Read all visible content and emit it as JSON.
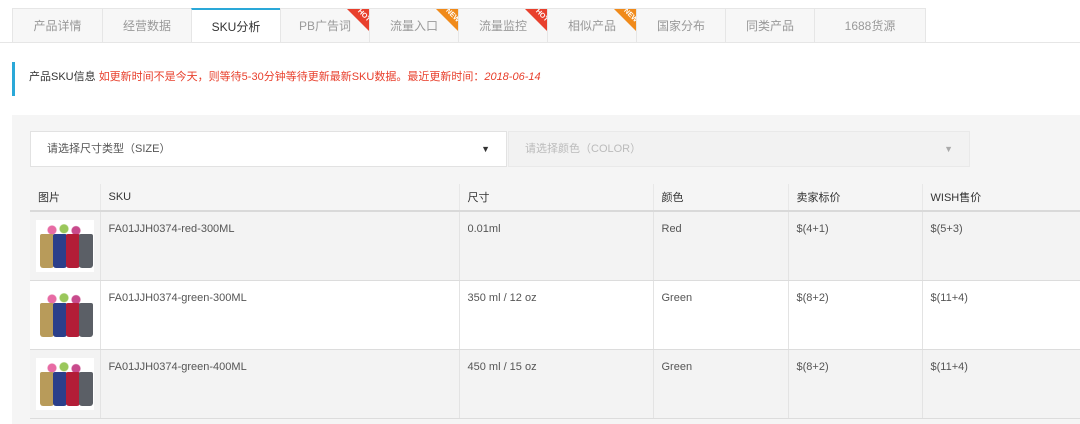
{
  "tabs": [
    {
      "label": "产品详情",
      "active": false,
      "badge": ""
    },
    {
      "label": "经营数据",
      "active": false,
      "badge": ""
    },
    {
      "label": "SKU分析",
      "active": true,
      "badge": ""
    },
    {
      "label": "PB广告词",
      "active": false,
      "badge": "HOT"
    },
    {
      "label": "流量入口",
      "active": false,
      "badge": "NEW"
    },
    {
      "label": "流量监控",
      "active": false,
      "badge": "HOT"
    },
    {
      "label": "相似产品",
      "active": false,
      "badge": "NEW"
    },
    {
      "label": "国家分布",
      "active": false,
      "badge": ""
    },
    {
      "label": "同类产品",
      "active": false,
      "badge": ""
    },
    {
      "label": "1688货源",
      "active": false,
      "badge": ""
    }
  ],
  "info": {
    "label": "产品SKU信息",
    "message": "如更新时间不是今天，则等待5-30分钟等待更新最新SKU数据。最近更新时间：",
    "date": "2018-06-14"
  },
  "filters": {
    "size_placeholder": "请选择尺寸类型（SIZE）",
    "color_placeholder": "请选择颜色（COLOR）",
    "caret": "▼"
  },
  "table": {
    "headers": [
      "图片",
      "SKU",
      "尺寸",
      "颜色",
      "卖家标价",
      "WISH售价"
    ],
    "rows": [
      {
        "sku": "FA01JJH0374-red-300ML",
        "size": "0.01ml",
        "color": "Red",
        "seller_price": "$(4+1)",
        "wish_price": "$(5+3)"
      },
      {
        "sku": "FA01JJH0374-green-300ML",
        "size": "350 ml / 12 oz",
        "color": "Green",
        "seller_price": "$(8+2)",
        "wish_price": "$(11+4)"
      },
      {
        "sku": "FA01JJH0374-green-400ML",
        "size": "450 ml / 15 oz",
        "color": "Green",
        "seller_price": "$(8+2)",
        "wish_price": "$(11+4)"
      }
    ]
  },
  "colors": {
    "accent": "#2aa8d8",
    "hot_badge": "#e8402d",
    "new_badge": "#f08a1a",
    "notice_text": "#e8402d"
  }
}
